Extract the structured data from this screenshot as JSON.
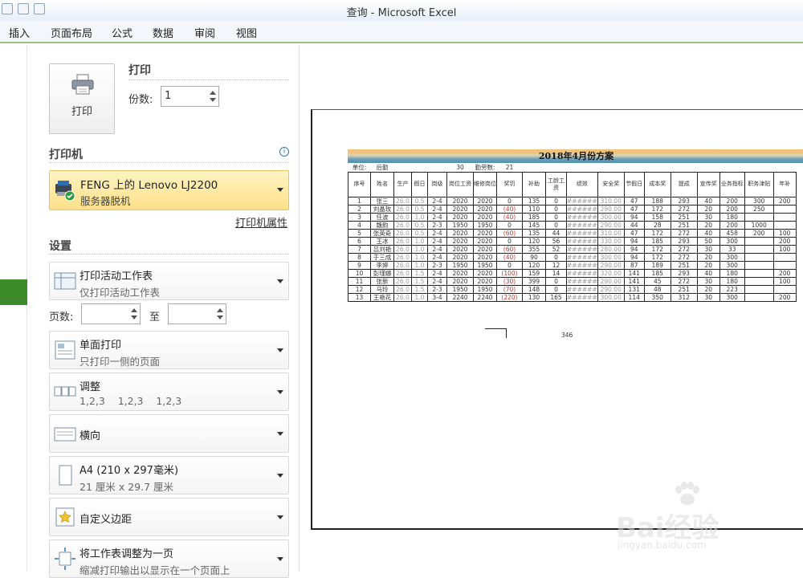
{
  "window": {
    "title": "查询 - Microsoft Excel"
  },
  "ribbon": {
    "tabs": [
      "插入",
      "页面布局",
      "公式",
      "数据",
      "审阅",
      "视图"
    ]
  },
  "print": {
    "button_label": "打印",
    "section_title": "打印",
    "copies_label": "份数:",
    "copies_value": "1"
  },
  "printer": {
    "section_title": "打印机",
    "info_glyph": "i",
    "name": "FENG 上的 Lenovo LJ2200",
    "status": "服务器脱机",
    "properties_link": "打印机属性"
  },
  "settings": {
    "section_title": "设置",
    "scope": {
      "title": "打印活动工作表",
      "sub": "仅打印活动工作表"
    },
    "pages_label": "页数:",
    "to_label": "至",
    "pages_from": "",
    "pages_to": "",
    "sides": {
      "title": "单面打印",
      "sub": "只打印一侧的页面"
    },
    "collate": {
      "title": "调整",
      "sub": "1,2,3    1,2,3    1,2,3"
    },
    "orientation": {
      "title": "横向"
    },
    "paper": {
      "title": "A4 (210 x 297毫米)",
      "sub": "21 厘米 x 29.7 厘米"
    },
    "margins": {
      "title": "自定义边距"
    },
    "scaling": {
      "title": "将工作表调整为一页",
      "sub": "缩减打印输出以显示在一个页面上"
    }
  },
  "preview": {
    "sheet_title": "2018年4月份方案",
    "meta_row": [
      "单位:",
      "后勤",
      "",
      "",
      "",
      "30",
      "勤劳数:",
      "21"
    ],
    "headers": [
      "序号",
      "姓名",
      "生产",
      "假日",
      "岗级",
      "岗位工资",
      "维修岗位",
      "奖罚",
      "补助",
      "工龄工资",
      "绩效",
      "安全奖",
      "节假日",
      "成本奖",
      "提成",
      "宣传奖",
      "业务指标",
      "职务津贴",
      "年补"
    ],
    "rows": [
      [
        "1",
        "张三",
        "26.0",
        "0.5",
        "2-4",
        "2020",
        "2020",
        "0",
        "135",
        "0",
        "######",
        "310.00",
        "47",
        "188",
        "293",
        "40",
        "200",
        "300",
        "200"
      ],
      [
        "2",
        "刘晶玫",
        "26.0",
        "0.5",
        "2-4",
        "2020",
        "2020",
        "(40)",
        "110",
        "0",
        "######",
        "290.00",
        "47",
        "172",
        "272",
        "20",
        "200",
        "250",
        ""
      ],
      [
        "3",
        "任波",
        "26.0",
        "1.0",
        "2-4",
        "2020",
        "2020",
        "(40)",
        "185",
        "0",
        "######",
        "300.00",
        "94",
        "158",
        "251",
        "30",
        "180",
        "",
        ""
      ],
      [
        "4",
        "魏韵",
        "26.0",
        "0.5",
        "2-3",
        "1950",
        "1950",
        "0",
        "145",
        "0",
        "######",
        "290.00",
        "44",
        "28",
        "251",
        "20",
        "200",
        "1000",
        ""
      ],
      [
        "5",
        "张英奇",
        "26.0",
        "0.5",
        "2-4",
        "2020",
        "2020",
        "(60)",
        "135",
        "44",
        "######",
        "310.00",
        "47",
        "172",
        "272",
        "40",
        "458",
        "200",
        "100"
      ],
      [
        "6",
        "王冰",
        "26.0",
        "1.0",
        "2-4",
        "2020",
        "2020",
        "0",
        "120",
        "56",
        "######",
        "330.00",
        "94",
        "185",
        "293",
        "50",
        "300",
        "",
        "200"
      ],
      [
        "7",
        "吕刘艳",
        "26.0",
        "1.0",
        "2-4",
        "2020",
        "2020",
        "(60)",
        "355",
        "52",
        "######",
        "280.00",
        "94",
        "172",
        "272",
        "30",
        "33",
        "",
        "100"
      ],
      [
        "8",
        "于三成",
        "26.0",
        "1.0",
        "2-4",
        "2020",
        "2020",
        "(40)",
        "90",
        "0",
        "######",
        "300.00",
        "94",
        "172",
        "272",
        "20",
        "300",
        "",
        ""
      ],
      [
        "9",
        "李婷",
        "26.0",
        "1.0",
        "2-3",
        "1950",
        "1950",
        "0",
        "120",
        "12",
        "######",
        "290.00",
        "87",
        "189",
        "251",
        "20",
        "300",
        "",
        ""
      ],
      [
        "10",
        "彭瑾娜",
        "26.0",
        "1.5",
        "2-4",
        "2020",
        "2020",
        "(100)",
        "159",
        "14",
        "######",
        "320.00",
        "141",
        "185",
        "293",
        "40",
        "180",
        "",
        "200"
      ],
      [
        "11",
        "张新",
        "26.0",
        "1.5",
        "2-4",
        "2020",
        "2020",
        "(30)",
        "399",
        "0",
        "######",
        "290.00",
        "141",
        "45",
        "272",
        "30",
        "180",
        "",
        "100"
      ],
      [
        "12",
        "马玲",
        "26.0",
        "1.5",
        "2-3",
        "1950",
        "1950",
        "(70)",
        "148",
        "0",
        "######",
        "290.00",
        "131",
        "48",
        "251",
        "20",
        "223",
        "",
        ""
      ],
      [
        "13",
        "王艳花",
        "26.0",
        "1.0",
        "3-4",
        "2240",
        "2240",
        "(220)",
        "130",
        "165",
        "######",
        "300.00",
        "114",
        "350",
        "312",
        "30",
        "300",
        "",
        "200"
      ]
    ],
    "total_value": "346"
  },
  "watermark": {
    "brand": "Bai经验",
    "url": "jingyan.baidu.com"
  },
  "colors": {
    "accent_green": "#3d8a2a",
    "printer_highlight": "#fde08a"
  }
}
